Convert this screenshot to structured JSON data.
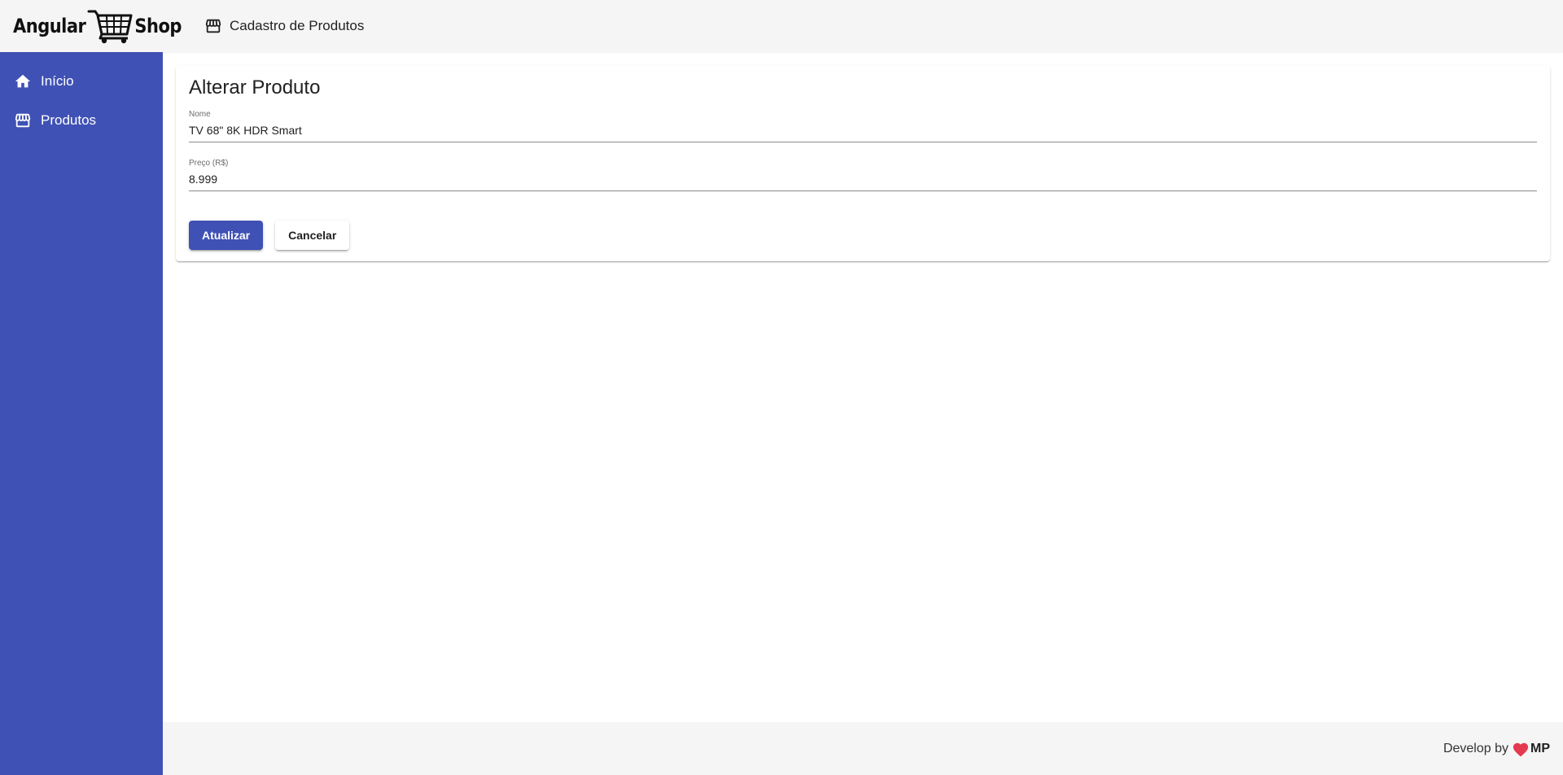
{
  "header": {
    "logo": {
      "left": "Angular",
      "right": "Shop"
    },
    "title": "Cadastro de Produtos",
    "title_icon": "storefront-icon"
  },
  "sidebar": {
    "items": [
      {
        "label": "Início",
        "icon": "home-icon"
      },
      {
        "label": "Produtos",
        "icon": "storefront-icon"
      }
    ]
  },
  "form": {
    "title": "Alterar Produto",
    "fields": [
      {
        "label": "Nome",
        "value": "TV 68\" 8K HDR Smart"
      },
      {
        "label": "Preço (R$)",
        "value": "8.999"
      }
    ],
    "submit_label": "Atualizar",
    "cancel_label": "Cancelar"
  },
  "footer": {
    "text": "Develop by",
    "brand": "MP",
    "heart_icon": "heart-icon"
  },
  "colors": {
    "primary": "#3f51b5",
    "header_bg": "#f5f5f5",
    "heart": "#e53950"
  }
}
